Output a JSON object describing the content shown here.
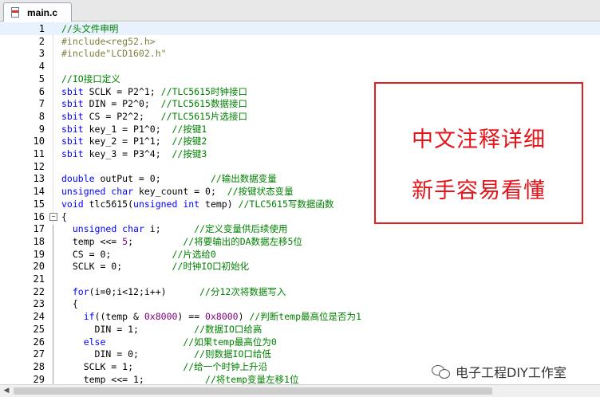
{
  "tab": {
    "filename": "main.c",
    "icon": "c-file-icon"
  },
  "lines": [
    {
      "n": "1",
      "tokens": [
        {
          "t": "cm",
          "s": "//头文件申明"
        }
      ]
    },
    {
      "n": "2",
      "tokens": [
        {
          "t": "pp",
          "s": "#include<reg52.h>"
        }
      ]
    },
    {
      "n": "3",
      "tokens": [
        {
          "t": "pp",
          "s": "#include\"LCD1602.h\""
        }
      ]
    },
    {
      "n": "4",
      "tokens": []
    },
    {
      "n": "5",
      "tokens": [
        {
          "t": "cm",
          "s": "//IO接口定义"
        }
      ]
    },
    {
      "n": "6",
      "tokens": [
        {
          "t": "kw",
          "s": "sbit"
        },
        {
          "t": "pl",
          "s": " SCLK = P2^1; "
        },
        {
          "t": "cm",
          "s": "//TLC5615时钟接口"
        }
      ]
    },
    {
      "n": "7",
      "tokens": [
        {
          "t": "kw",
          "s": "sbit"
        },
        {
          "t": "pl",
          "s": " DIN = P2^0;  "
        },
        {
          "t": "cm",
          "s": "//TLC5615数据接口"
        }
      ]
    },
    {
      "n": "8",
      "tokens": [
        {
          "t": "kw",
          "s": "sbit"
        },
        {
          "t": "pl",
          "s": " CS = P2^2;   "
        },
        {
          "t": "cm",
          "s": "//TLC5615片选接口"
        }
      ]
    },
    {
      "n": "9",
      "tokens": [
        {
          "t": "kw",
          "s": "sbit"
        },
        {
          "t": "pl",
          "s": " key_1 = P1^0;  "
        },
        {
          "t": "cm",
          "s": "//按键1"
        }
      ]
    },
    {
      "n": "10",
      "tokens": [
        {
          "t": "kw",
          "s": "sbit"
        },
        {
          "t": "pl",
          "s": " key_2 = P1^1;  "
        },
        {
          "t": "cm",
          "s": "//按键2"
        }
      ]
    },
    {
      "n": "11",
      "tokens": [
        {
          "t": "kw",
          "s": "sbit"
        },
        {
          "t": "pl",
          "s": " key_3 = P3^4;  "
        },
        {
          "t": "cm",
          "s": "//按键3"
        }
      ]
    },
    {
      "n": "12",
      "tokens": []
    },
    {
      "n": "13",
      "tokens": [
        {
          "t": "kw",
          "s": "double"
        },
        {
          "t": "pl",
          "s": " outPut = 0;         "
        },
        {
          "t": "cm",
          "s": "//输出数据变量"
        }
      ]
    },
    {
      "n": "14",
      "tokens": [
        {
          "t": "kw",
          "s": "unsigned char"
        },
        {
          "t": "pl",
          "s": " key_count = 0;  "
        },
        {
          "t": "cm",
          "s": "//按键状态变量"
        }
      ]
    },
    {
      "n": "15",
      "tokens": [
        {
          "t": "kw",
          "s": "void"
        },
        {
          "t": "pl",
          "s": " tlc5615("
        },
        {
          "t": "kw",
          "s": "unsigned int"
        },
        {
          "t": "pl",
          "s": " temp) "
        },
        {
          "t": "cm",
          "s": "//TLC5615写数据函数"
        }
      ]
    },
    {
      "n": "16",
      "tokens": [
        {
          "t": "pl",
          "s": "{"
        }
      ]
    },
    {
      "n": "17",
      "tokens": [
        {
          "t": "pl",
          "s": "  "
        },
        {
          "t": "kw",
          "s": "unsigned char"
        },
        {
          "t": "pl",
          "s": " i;      "
        },
        {
          "t": "cm",
          "s": "//定义变量供后续使用"
        }
      ]
    },
    {
      "n": "18",
      "tokens": [
        {
          "t": "pl",
          "s": "  temp <<= "
        },
        {
          "t": "num",
          "s": "5"
        },
        {
          "t": "pl",
          "s": ";         "
        },
        {
          "t": "cm",
          "s": "//将要输出的DA数据左移5位"
        }
      ]
    },
    {
      "n": "19",
      "tokens": [
        {
          "t": "pl",
          "s": "  CS = 0;           "
        },
        {
          "t": "cm",
          "s": "//片选给0"
        }
      ]
    },
    {
      "n": "20",
      "tokens": [
        {
          "t": "pl",
          "s": "  SCLK = 0;         "
        },
        {
          "t": "cm",
          "s": "//时钟IO口初始化"
        }
      ]
    },
    {
      "n": "21",
      "tokens": []
    },
    {
      "n": "22",
      "tokens": [
        {
          "t": "pl",
          "s": "  "
        },
        {
          "t": "kw",
          "s": "for"
        },
        {
          "t": "pl",
          "s": "(i=0;i<12;i++)      "
        },
        {
          "t": "cm",
          "s": "//分12次将数据写入"
        }
      ]
    },
    {
      "n": "23",
      "tokens": [
        {
          "t": "pl",
          "s": "  {"
        }
      ]
    },
    {
      "n": "24",
      "tokens": [
        {
          "t": "pl",
          "s": "    "
        },
        {
          "t": "kw",
          "s": "if"
        },
        {
          "t": "pl",
          "s": "((temp & "
        },
        {
          "t": "num",
          "s": "0x8000"
        },
        {
          "t": "pl",
          "s": ") == "
        },
        {
          "t": "num",
          "s": "0x8000"
        },
        {
          "t": "pl",
          "s": ") "
        },
        {
          "t": "cm",
          "s": "//判断temp最高位是否为1"
        }
      ]
    },
    {
      "n": "25",
      "tokens": [
        {
          "t": "pl",
          "s": "      DIN = 1;          "
        },
        {
          "t": "cm",
          "s": "//数据IO口给高"
        }
      ]
    },
    {
      "n": "26",
      "tokens": [
        {
          "t": "pl",
          "s": "    "
        },
        {
          "t": "kw",
          "s": "else"
        },
        {
          "t": "pl",
          "s": "              "
        },
        {
          "t": "cm",
          "s": "//如果temp最高位为0"
        }
      ]
    },
    {
      "n": "27",
      "tokens": [
        {
          "t": "pl",
          "s": "      DIN = 0;          "
        },
        {
          "t": "cm",
          "s": "//则数据IO口给低"
        }
      ]
    },
    {
      "n": "28",
      "tokens": [
        {
          "t": "pl",
          "s": "    SCLK = 1;         "
        },
        {
          "t": "cm",
          "s": "//给一个时钟上升沿"
        }
      ]
    },
    {
      "n": "29",
      "tokens": [
        {
          "t": "pl",
          "s": "    temp <<= 1;           "
        },
        {
          "t": "cm",
          "s": "//将temp变量左移1位"
        }
      ]
    }
  ],
  "current_line": "1",
  "folds": [
    "16",
    "23"
  ],
  "callout": {
    "line1": "中文注释详细",
    "line2": "新手容易看懂"
  },
  "watermark": {
    "text": "电子工程DIY工作室",
    "icon": "wechat-icon"
  },
  "colors": {
    "keyword": "#0000ff",
    "comment": "#008000",
    "preprocessor": "#7f7f3f",
    "number": "#7f007f",
    "callout": "#e5141b"
  }
}
